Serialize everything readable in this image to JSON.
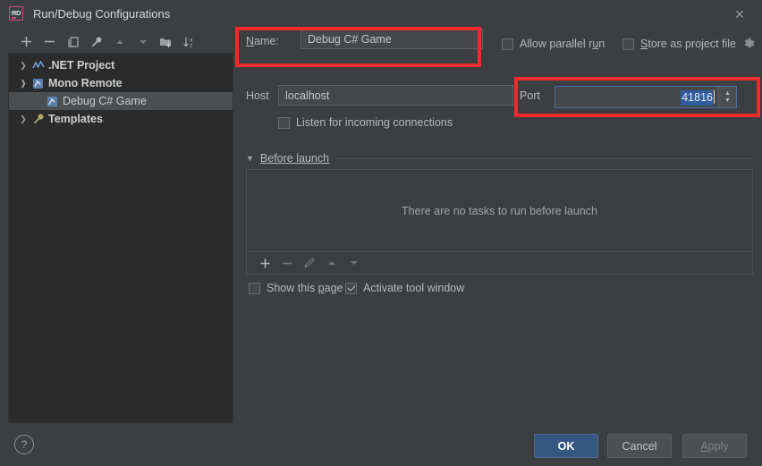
{
  "window": {
    "title": "Run/Debug Configurations",
    "app_icon": "RD",
    "close_icon": "✕"
  },
  "tree_toolbar": {
    "items": [
      {
        "name": "add-configuration-button",
        "icon": "plus-icon",
        "enabled": true
      },
      {
        "name": "remove-configuration-button",
        "icon": "minus-icon",
        "enabled": true
      },
      {
        "name": "copy-configuration-button",
        "icon": "copy-icon",
        "enabled": true
      },
      {
        "name": "edit-templates-button",
        "icon": "wrench-icon",
        "enabled": true
      },
      {
        "name": "move-up-button",
        "icon": "arrow-up-icon",
        "enabled": false
      },
      {
        "name": "move-down-button",
        "icon": "arrow-down-icon",
        "enabled": false
      },
      {
        "name": "new-folder-button",
        "icon": "folder-plus-icon",
        "enabled": true
      },
      {
        "name": "sort-configurations-button",
        "icon": "sort-az-icon",
        "enabled": true
      }
    ]
  },
  "tree": {
    "items": [
      {
        "label": ".NET Project",
        "icon": "dotnet-project-icon",
        "expander": "collapsed",
        "level": 0,
        "bold": true,
        "selected": false
      },
      {
        "label": "Mono Remote",
        "icon": "mono-remote-icon",
        "expander": "expanded",
        "level": 0,
        "bold": true,
        "selected": false
      },
      {
        "label": "Debug C# Game",
        "icon": "mono-remote-icon",
        "expander": "none",
        "level": 1,
        "bold": false,
        "selected": true
      },
      {
        "label": "Templates",
        "icon": "wrench-icon",
        "expander": "collapsed",
        "level": 0,
        "bold": true,
        "selected": false
      }
    ]
  },
  "form": {
    "name_label": "Name:",
    "name_mnemonic": "N",
    "name_value": "Debug C# Game",
    "allow_parallel_run": {
      "label": "Allow parallel run",
      "mnemonic": "u",
      "checked": false
    },
    "store_as_project_file": {
      "label": "Store as project file",
      "mnemonic": "S",
      "checked": false
    },
    "store_gear_icon": "gear-icon",
    "host_label": "Host",
    "host_value": "localhost",
    "port_label": "Port",
    "port_value": "41816",
    "listen_incoming": {
      "label": "Listen for incoming connections",
      "checked": false
    },
    "before_launch": {
      "label": "Before launch",
      "mnemonic": "B",
      "expanded": true,
      "empty_text": "There are no tasks to run before launch",
      "toolbar": [
        {
          "name": "add-task-button",
          "icon": "plus-icon",
          "enabled": true
        },
        {
          "name": "remove-task-button",
          "icon": "minus-icon",
          "enabled": false
        },
        {
          "name": "edit-task-button",
          "icon": "pencil-icon",
          "enabled": false
        },
        {
          "name": "task-move-up-button",
          "icon": "arrow-up-icon",
          "enabled": false
        },
        {
          "name": "task-move-down-button",
          "icon": "arrow-down-icon",
          "enabled": false
        }
      ]
    },
    "show_this_page": {
      "label": "Show this page",
      "mnemonic": "p",
      "checked": false
    },
    "activate_tool_window": {
      "label": "Activate tool window",
      "checked": true
    }
  },
  "footer": {
    "help_label": "?",
    "ok_label": "OK",
    "cancel_label": "Cancel",
    "apply_label": "Apply",
    "apply_mnemonic": "A"
  },
  "annotations": {
    "color": "#ef2a2a",
    "boxes": [
      {
        "name": "name-field-highlight"
      },
      {
        "name": "port-field-highlight"
      }
    ]
  }
}
